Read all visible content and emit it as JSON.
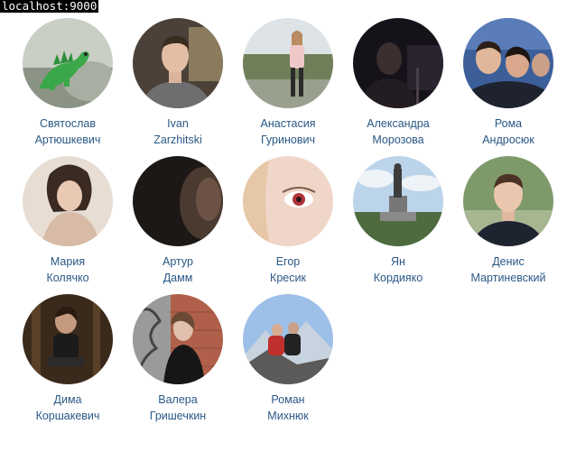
{
  "browser": {
    "url_label": "localhost:9000"
  },
  "friends": [
    {
      "first": "Святослав",
      "last": "Артюшкевич",
      "avatar_icon": "dinosaur-toy-photo"
    },
    {
      "first": "Ivan",
      "last": "Zarzhitski",
      "avatar_icon": "boy-portrait-photo"
    },
    {
      "first": "Анастасия",
      "last": "Гуринович",
      "avatar_icon": "girl-outdoor-photo"
    },
    {
      "first": "Александра",
      "last": "Морозова",
      "avatar_icon": "dark-night-photo"
    },
    {
      "first": "Рома",
      "last": "Андросюк",
      "avatar_icon": "group-selfie-photo"
    },
    {
      "first": "Мария",
      "last": "Колячко",
      "avatar_icon": "girl-portrait-photo"
    },
    {
      "first": "Артур",
      "last": "Дамм",
      "avatar_icon": "dark-face-photo"
    },
    {
      "first": "Егор",
      "last": "Кресик",
      "avatar_icon": "eye-closeup-photo"
    },
    {
      "first": "Ян",
      "last": "Кордияко",
      "avatar_icon": "monument-photo"
    },
    {
      "first": "Денис",
      "last": "Мартиневский",
      "avatar_icon": "man-portrait-photo"
    },
    {
      "first": "Дима",
      "last": "Коршакевич",
      "avatar_icon": "forest-sitting-photo"
    },
    {
      "first": "Валера",
      "last": "Гришечкин",
      "avatar_icon": "graffiti-wall-photo"
    },
    {
      "first": "Роман",
      "last": "Михнюк",
      "avatar_icon": "mountain-couple-photo"
    }
  ]
}
